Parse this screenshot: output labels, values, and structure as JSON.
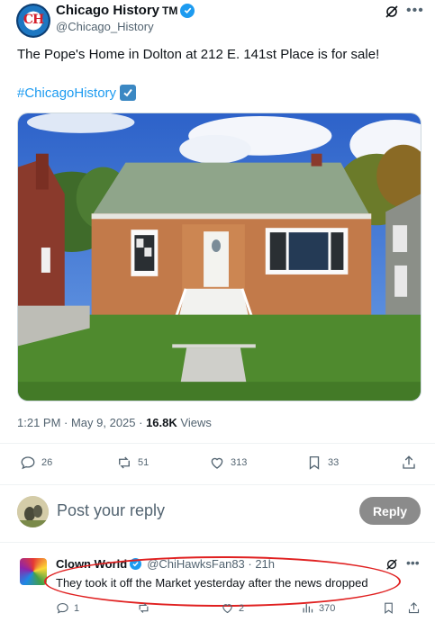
{
  "post": {
    "display_name": "Chicago History",
    "tm": "TM",
    "handle": "@Chicago_History",
    "avatar_text": "CH",
    "text": "The Pope's Home in Dolton at 212 E. 141st Place is for sale!",
    "hashtag": "#ChicagoHistory",
    "time": "1:21 PM · May 9, 2025 · ",
    "views_count": "16.8K",
    "views_label": " Views",
    "replies": "26",
    "reposts": "51",
    "likes": "313",
    "bookmarks": "33"
  },
  "composer": {
    "placeholder": "Post your reply",
    "reply_button": "Reply"
  },
  "reply": {
    "display_name": "Clown World",
    "handle": "@ChiHawksFan83 · 21h",
    "text": "They took it off the Market yesterday after the news dropped",
    "replies": "1",
    "reposts": "",
    "likes": "2",
    "views": "370"
  },
  "icons": [
    "verified-badge-icon",
    "grok-icon",
    "more-icon",
    "checkbox-emoji-icon",
    "reply-icon",
    "repost-icon",
    "like-icon",
    "bookmark-icon",
    "share-icon",
    "views-icon"
  ],
  "colors": {
    "accent": "#1d9bf0",
    "muted": "#536471",
    "highlight": "#e02020",
    "reply_button": "#8b8b8b"
  }
}
